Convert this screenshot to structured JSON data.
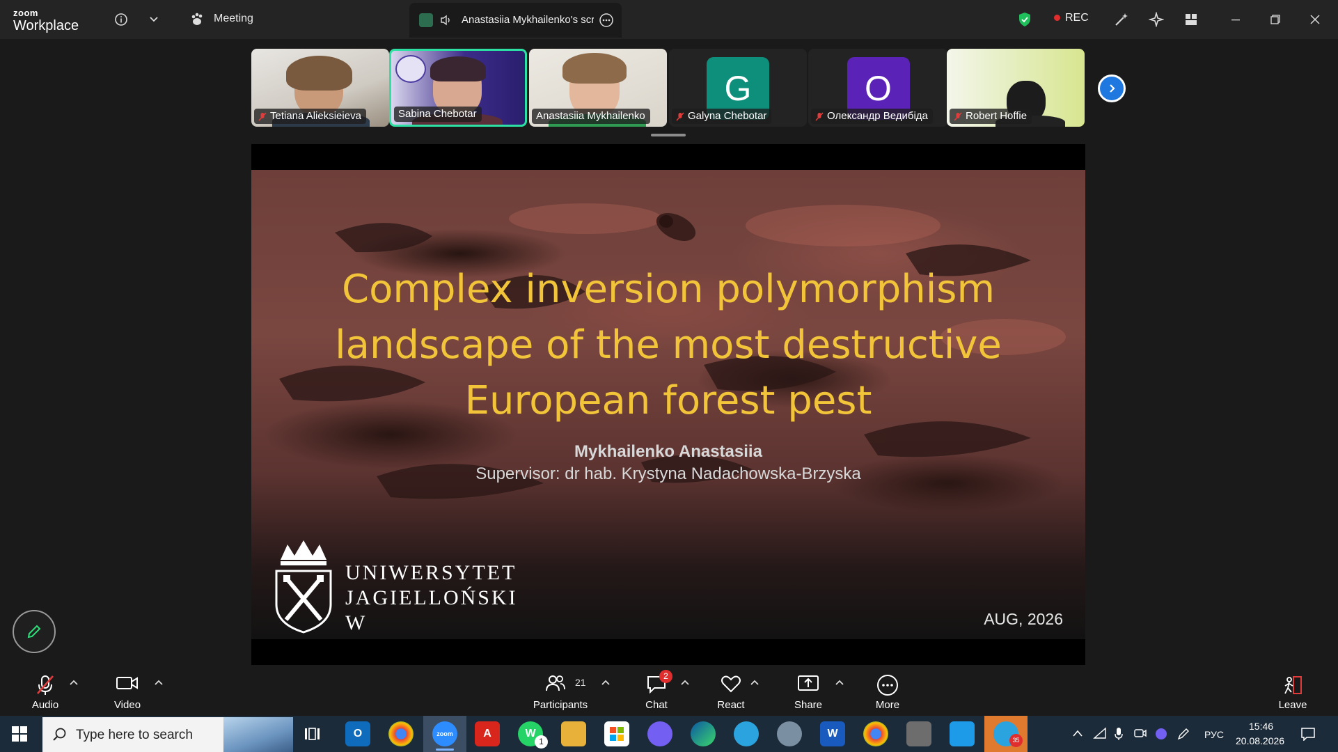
{
  "titlebar": {
    "brand_top": "zoom",
    "brand_bottom": "Workplace",
    "meeting_label": "Meeting",
    "share_tab_label": "Anastasiia Mykhailenko's scre",
    "rec_label": "REC"
  },
  "participants_strip": [
    {
      "name": "Tetiana Alieksieieva",
      "muted": true,
      "type": "video"
    },
    {
      "name": "Sabina Chebotar",
      "muted": false,
      "type": "video",
      "active": true
    },
    {
      "name": "Anastasiia Mykhailenko",
      "muted": false,
      "type": "video"
    },
    {
      "name": "Galyna Chebotar",
      "muted": true,
      "type": "avatar",
      "initial": "G",
      "color": "#0d8f7b"
    },
    {
      "name": "Олександр Ведибіда",
      "muted": true,
      "type": "avatar",
      "initial": "О",
      "color": "#5b22b8"
    },
    {
      "name": "Robert Hoffie",
      "muted": true,
      "type": "video"
    }
  ],
  "slide": {
    "title_lines": [
      "Complex inversion polymorphism",
      "landscape of the most destructive",
      "European forest pest"
    ],
    "author": "Mykhailenko Anastasiia",
    "supervisor": "Supervisor: dr hab. Krystyna Nadachowska-Brzyska",
    "university_lines": [
      "UNIWERSYTET",
      "JAGIELLOŃSKI",
      "W KRAKOWIE"
    ],
    "date": "AUG, 2026"
  },
  "toolbar": {
    "audio_label": "Audio",
    "video_label": "Video",
    "participants_label": "Participants",
    "participants_count": "21",
    "chat_label": "Chat",
    "chat_badge": "2",
    "react_label": "React",
    "share_label": "Share",
    "more_label": "More",
    "leave_label": "Leave"
  },
  "taskbar": {
    "search_placeholder": "Type here to search",
    "whatsapp_badge": "1",
    "telegram_badge": "35",
    "language": "РУС",
    "time": "15:46",
    "date": "20.08.2026"
  },
  "colors": {
    "accent_active": "#2de0a4",
    "title_yellow": "#f2c43a",
    "rec_red": "#e02e2e",
    "zoom_blue": "#1f78e0"
  }
}
